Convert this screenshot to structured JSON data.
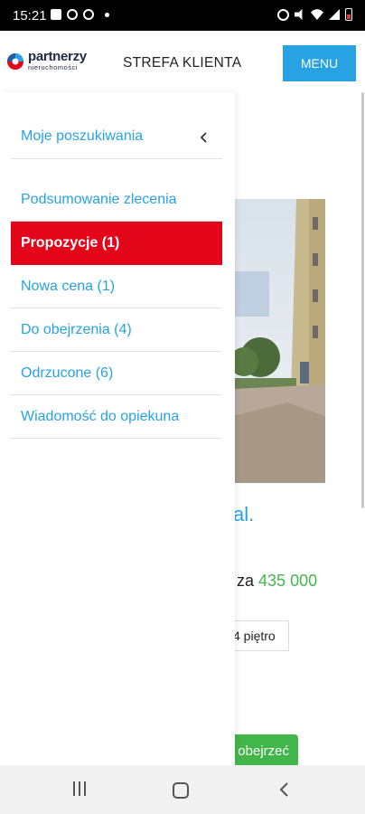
{
  "status_bar": {
    "time": "15:21"
  },
  "header": {
    "logo_text": "partnerzy",
    "logo_subtext": "nieruchomości",
    "title": "STREFA KLIENTA",
    "menu_label": "MENU"
  },
  "drawer": {
    "section_label": "Moje poszukiwania",
    "items": [
      {
        "label": "Podsumowanie zlecenia",
        "active": false
      },
      {
        "label": "Propozycje (1)",
        "active": true
      },
      {
        "label": "Nowa cena (1)",
        "active": false
      },
      {
        "label": "Do obejrzenia (4)",
        "active": false
      },
      {
        "label": "Odrzucone (6)",
        "active": false
      },
      {
        "label": "Wiadomość do opiekuna",
        "active": false
      }
    ]
  },
  "background_content": {
    "title_fragment": "al.",
    "price_prefix": "za",
    "price": "435 000",
    "floor_chip": "4 piętro",
    "watch_button": "obejrzeć"
  },
  "colors": {
    "accent_blue": "#27a3e4",
    "active_red": "#e3061b",
    "price_green": "#43b64b"
  }
}
